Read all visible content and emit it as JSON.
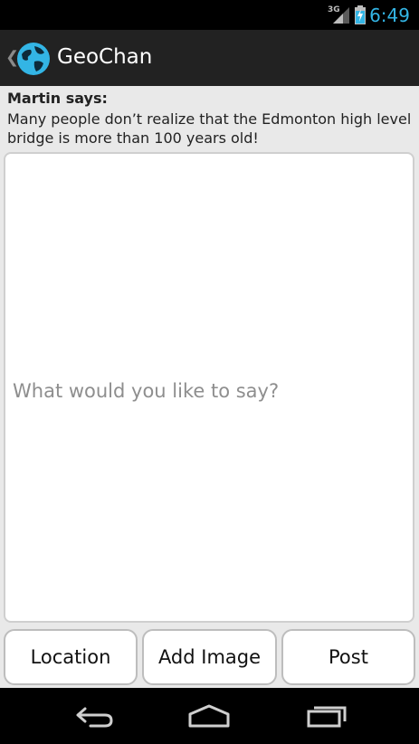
{
  "status_bar": {
    "network": "3G",
    "time": "6:49",
    "icons": [
      "signal-icon",
      "battery-charging-icon"
    ]
  },
  "action_bar": {
    "title": "GeoChan",
    "icons": [
      "up-caret-icon",
      "globe-logo-icon"
    ]
  },
  "post": {
    "author_label": "Martin says:",
    "text": "Many people don’t realize that the Edmonton high level bridge is more than 100 years old!"
  },
  "compose": {
    "placeholder": "What would you like to say?"
  },
  "buttons": {
    "location": "Location",
    "add_image": "Add Image",
    "post": "Post"
  },
  "nav_bar": {
    "icons": [
      "back-icon",
      "home-icon",
      "recent-apps-icon"
    ]
  },
  "colors": {
    "accent": "#33b5e5",
    "action_bar": "#222222",
    "background": "#e9e9e9"
  }
}
